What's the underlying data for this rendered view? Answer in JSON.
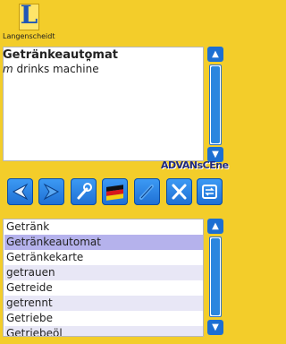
{
  "app": {
    "brand": "Langenscheidt",
    "logo_letter": "L"
  },
  "entry": {
    "headword": "Getränkeauto̪mat",
    "pos": "m",
    "translation": "drinks machine"
  },
  "watermark": "ADVANsCEne",
  "toolbar": {
    "buttons": [
      {
        "icon": "arrow-left-icon"
      },
      {
        "icon": "arrow-right-icon"
      },
      {
        "icon": "wrench-icon"
      },
      {
        "icon": "german-flag-icon"
      },
      {
        "icon": "pencil-icon"
      },
      {
        "icon": "close-icon"
      },
      {
        "icon": "swap-icon"
      }
    ]
  },
  "wordlist": {
    "selected_index": 1,
    "items": [
      "Getränk",
      "Getränkeautomat",
      "Getränkekarte",
      "getrauen",
      "Getreide",
      "getrennt",
      "Getriebe",
      "Getriebeöl"
    ]
  },
  "scroll": {
    "up_glyph": "▲",
    "down_glyph": "▼"
  },
  "colors": {
    "background": "#f3cd2a",
    "accent": "#1f6fd3",
    "selection": "#b5b2ec"
  }
}
